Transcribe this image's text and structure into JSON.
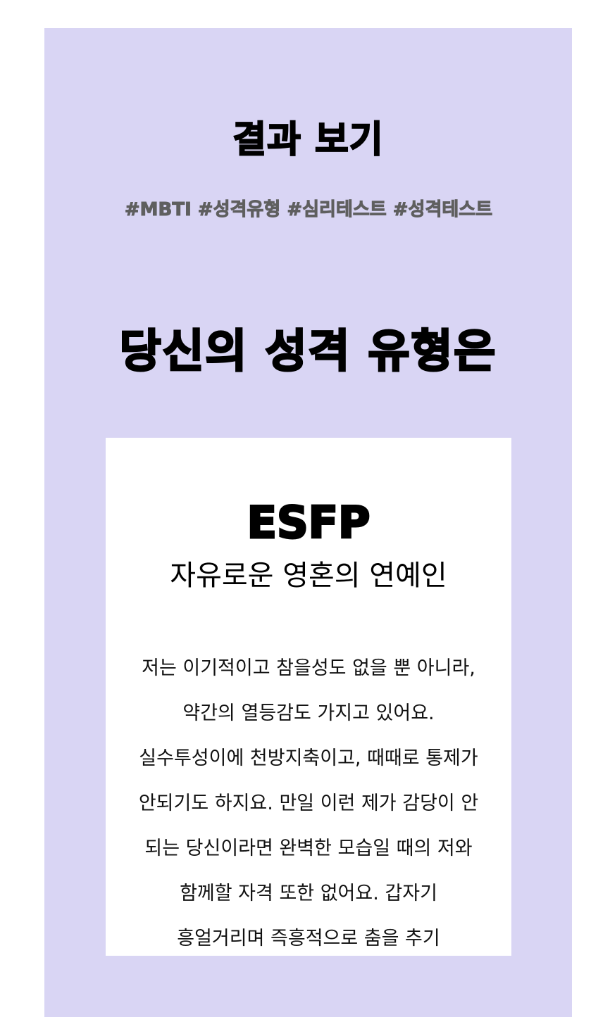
{
  "result": {
    "title": "결과 보기",
    "hashtags": "#MBTI #성격유형 #심리테스트 #성격테스트",
    "headline": "당신의 성격 유형은",
    "type_code": "ESFP",
    "type_name": "자유로운 영혼의 연예인",
    "description": "저는 이기적이고 참을성도 없을 뿐 아니라, 약간의 열등감도 가지고 있어요. 실수투성이에 천방지축이고, 때때로 통제가 안되기도 하지요. 만일 이런 제가 감당이 안 되는 당신이라면 완벽한 모습일 때의 저와 함께할 자격 또한 없어요. 갑자기 흥얼거리며 즉흥적으로 춤을 추기"
  },
  "colors": {
    "panel_background": "#d9d5f4",
    "card_background": "#ffffff",
    "hashtag_text": "#5f5f5f",
    "page_background": "#ffffff"
  }
}
